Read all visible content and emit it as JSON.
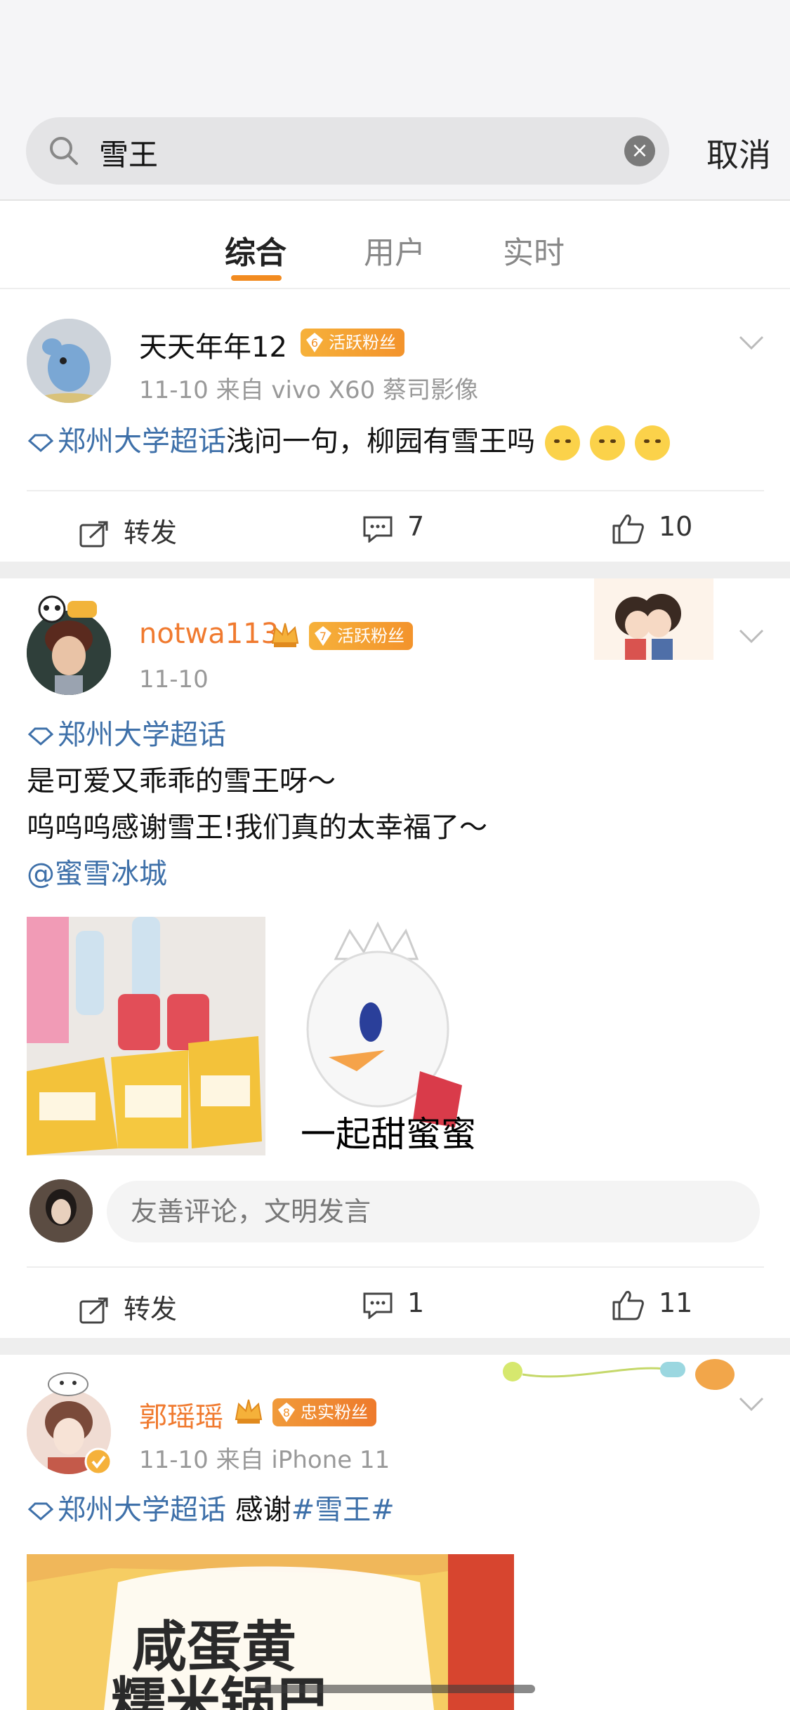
{
  "search": {
    "query": "雪王",
    "cancel_label": "取消"
  },
  "tabs": [
    {
      "label": "综合",
      "active": true
    },
    {
      "label": "用户",
      "active": false
    },
    {
      "label": "实时",
      "active": false
    }
  ],
  "posts": [
    {
      "user": "天天年年12",
      "badge_level": "6",
      "badge_text": "活跃粉丝",
      "meta": "11-10  来自 vivo X60 蔡司影像",
      "topic": "郑州大学超话",
      "text": "浅问一句，柳园有雪王吗",
      "actions": {
        "repost": "转发",
        "comments": "7",
        "likes": "10"
      }
    },
    {
      "user": "notwa113",
      "badge_level": "7",
      "badge_text": "活跃粉丝",
      "meta": "11-10",
      "topic": "郑州大学超话",
      "line1": "是可爱又乖乖的雪王呀～",
      "line2": "呜呜呜感谢雪王!我们真的太幸福了～",
      "mention": "@蜜雪冰城",
      "image2_caption": "一起甜蜜蜜",
      "comment_placeholder": "友善评论，文明发言",
      "actions": {
        "repost": "转发",
        "comments": "1",
        "likes": "11"
      }
    },
    {
      "user": "郭瑶瑶",
      "badge_level": "8",
      "badge_text": "忠实粉丝",
      "meta": "11-10  来自 iPhone 11",
      "topic": "郑州大学超话",
      "text_prefix": " 感谢",
      "hashtag": "#雪王#",
      "image_text1": "咸蛋黄",
      "image_text2": "糯米锅巴"
    }
  ],
  "colors": {
    "accent": "#f28b20",
    "link": "#3e70a9",
    "vip_name": "#f07a2f"
  }
}
